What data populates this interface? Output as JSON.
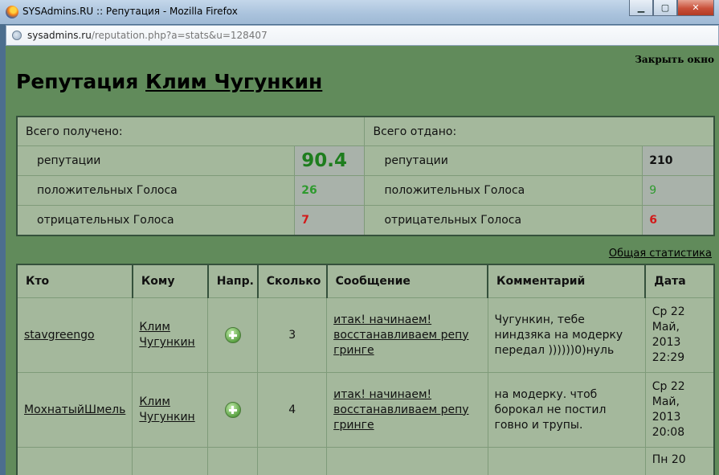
{
  "window": {
    "title": "SYSAdmins.RU :: Репутация - Mozilla Firefox"
  },
  "address": {
    "domain": "sysadmins.ru",
    "path": "/reputation.php?a=stats&u=128407"
  },
  "page": {
    "close_label": "Закрыть окно",
    "title_prefix": "Репутация ",
    "user_name": "Клим Чугункин",
    "stats_link": "Общая статистика"
  },
  "summary": {
    "received_header": "Всего получено:",
    "given_header": "Всего отдано:",
    "rows": [
      {
        "label": "репутации",
        "received": "90.4",
        "given_label": "репутации",
        "given": "210"
      },
      {
        "label": "положительных Голоса",
        "received": "26",
        "given_label": "положительных Голоса",
        "given": "9"
      },
      {
        "label": "отрицательных Голоса",
        "received": "7",
        "given_label": "отрицательных Голоса",
        "given": "6"
      }
    ]
  },
  "log": {
    "columns": [
      "Кто",
      "Кому",
      "Напр.",
      "Сколько",
      "Сообщение",
      "Комментарий",
      "Дата"
    ],
    "rows": [
      {
        "who": "stavgreengo",
        "to": "Клим Чугункин",
        "direction": "plus-icon",
        "amount": "3",
        "message": "итак! начинаем! восстанавливаем репу гринге",
        "comment": "Чугункин, тебе ниндзяка на модерку передал ))))))0)нуль",
        "date": "Ср 22 Май, 2013 22:29"
      },
      {
        "who": "МохнатыйШмель",
        "to": "Клим Чугункин",
        "direction": "plus-icon",
        "amount": "4",
        "message": "итак! начинаем! восстанавливаем репу гринге",
        "comment": "на модерку. чтоб борокал не постил говно и трупы.",
        "date": "Ср 22 Май, 2013 20:08"
      },
      {
        "date_partial": "Пн 20"
      }
    ]
  }
}
